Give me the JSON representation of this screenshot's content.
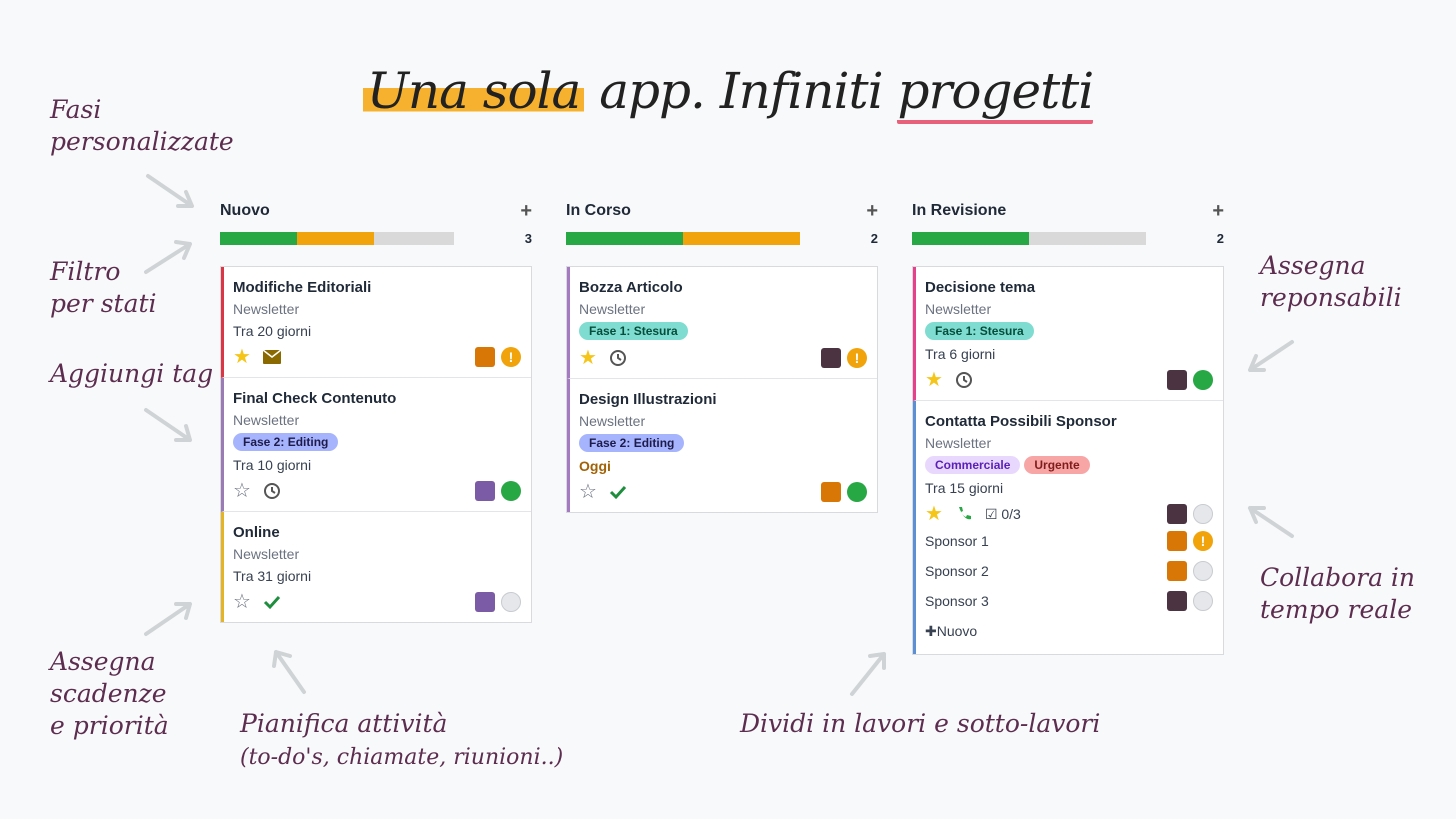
{
  "headline": {
    "part1": "Una sola",
    "part2": " app. Infiniti ",
    "part3": "progetti"
  },
  "notes": {
    "fasi": "Fasi\npersonalizzate",
    "filtro": "Filtro\nper stati",
    "tag": "Aggiungi tag",
    "scadenze": "Assegna\nscadenze\ne priorità",
    "pianifica": "Pianifica attività",
    "pianifica_sub": "(to-do's, chiamate, riunioni..)",
    "dividi": "Dividi in lavori e sotto-lavori",
    "responsabili": "Assegna\nreponsabili",
    "collabora": "Collabora in\ntempo reale"
  },
  "colors": {
    "green": "#28a745",
    "orange": "#f0a30a",
    "grey": "#d9d9d9",
    "accent": "#5c2d4f"
  },
  "columns": [
    {
      "title": "Nuovo",
      "count": "3",
      "bar": [
        0.33,
        0.33
      ],
      "cards": [
        {
          "title": "Modifiche Editoriali",
          "project": "Newsletter",
          "date": "Tra 20 giorni",
          "star": true,
          "activity": "envelope-icon",
          "avatar": "#d97706",
          "status": "warn",
          "border": "#dc3545",
          "tags": []
        },
        {
          "title": "Final Check Contenuto",
          "project": "Newsletter",
          "date": "Tra 10 giorni",
          "star": false,
          "activity": "clock-icon",
          "avatar": "#7c5ba6",
          "status": "green",
          "border": "#9b7bb5",
          "tags": [
            {
              "label": "Fase 2: Editing",
              "bg": "#a5b4fc",
              "fg": "#1e1b4b"
            }
          ]
        },
        {
          "title": "Online",
          "project": "Newsletter",
          "date": "Tra 31 giorni",
          "star": false,
          "activity": "check-icon",
          "avatar": "#7c5ba6",
          "status": "grey",
          "border": "#e6b422",
          "tags": []
        }
      ]
    },
    {
      "title": "In Corso",
      "count": "2",
      "bar": [
        0.5,
        0.5
      ],
      "cards": [
        {
          "title": "Bozza Articolo",
          "project": "Newsletter",
          "date": "",
          "star": true,
          "activity": "clock-icon",
          "avatar": "#4b3342",
          "status": "warn",
          "border": "#a57ac2",
          "tags": [
            {
              "label": "Fase 1: Stesura",
              "bg": "#7fdcd0",
              "fg": "#064e3b"
            }
          ]
        },
        {
          "title": "Design Illustrazioni",
          "project": "Newsletter",
          "date": "Oggi",
          "today": true,
          "star": false,
          "activity": "check-icon",
          "avatar": "#d97706",
          "status": "green",
          "border": "#a57ac2",
          "tags": [
            {
              "label": "Fase 2: Editing",
              "bg": "#a5b4fc",
              "fg": "#1e1b4b"
            }
          ]
        }
      ]
    },
    {
      "title": "In Revisione",
      "count": "2",
      "bar": [
        0.5,
        0
      ],
      "cards": [
        {
          "title": "Decisione tema",
          "project": "Newsletter",
          "date": "Tra 6 giorni",
          "star": true,
          "activity": "clock-icon",
          "avatar": "#4b3342",
          "status": "green",
          "border": "#e83e8c",
          "tags": [
            {
              "label": "Fase 1: Stesura",
              "bg": "#7fdcd0",
              "fg": "#064e3b"
            }
          ]
        },
        {
          "title": "Contatta Possibili Sponsor",
          "project": "Newsletter",
          "date": "Tra 15 giorni",
          "star": true,
          "activity": "phone-icon",
          "checklist": "0/3",
          "avatar": "#4b3342",
          "status": "grey",
          "border": "#5b8fd6",
          "tags": [
            {
              "label": "Commerciale",
              "bg": "#e9d8fd",
              "fg": "#5b21b6"
            },
            {
              "label": "Urgente",
              "bg": "#f8a5a5",
              "fg": "#7f1d1d"
            }
          ],
          "subtasks": [
            {
              "label": "Sponsor 1",
              "avatar": "#d97706",
              "status": "warn"
            },
            {
              "label": "Sponsor 2",
              "avatar": "#d97706",
              "status": "grey"
            },
            {
              "label": "Sponsor 3",
              "avatar": "#4b3342",
              "status": "grey"
            }
          ],
          "add_label": "Nuovo"
        }
      ]
    }
  ]
}
